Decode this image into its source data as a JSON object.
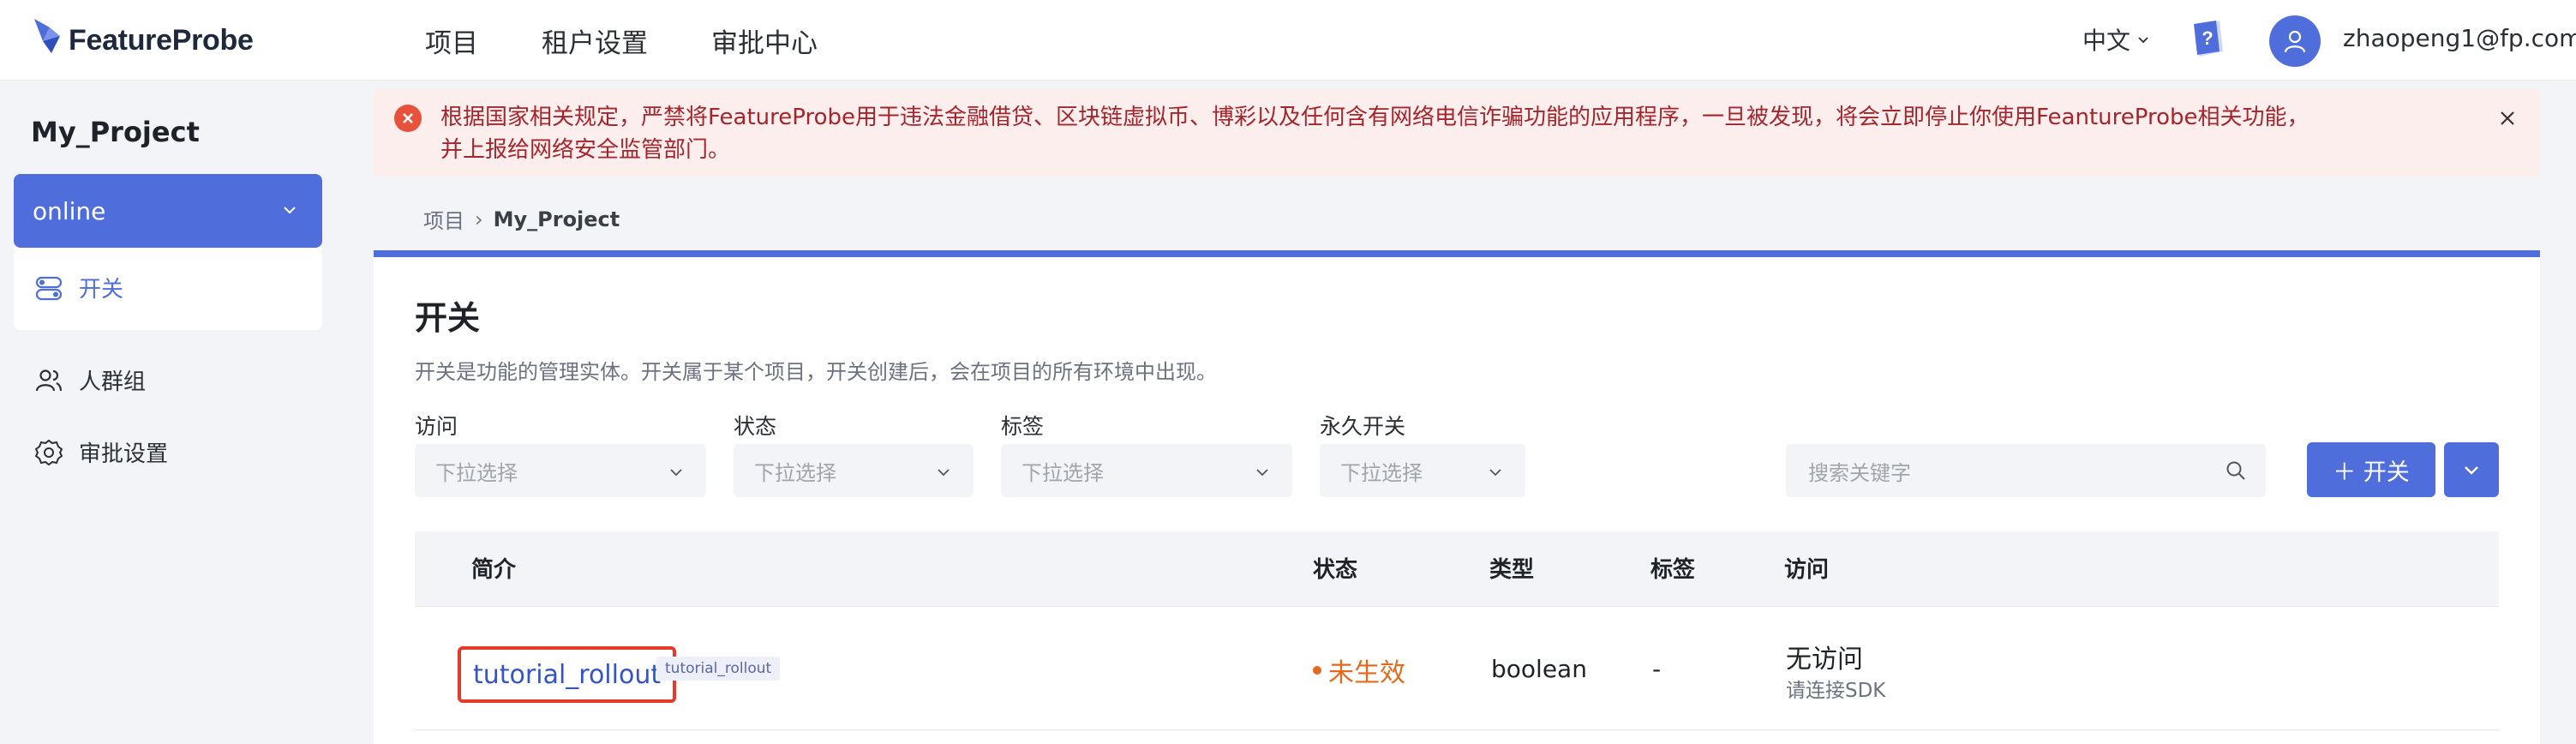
{
  "app": {
    "name": "FeatureProbe"
  },
  "nav": {
    "items": [
      "项目",
      "租户设置",
      "审批中心"
    ]
  },
  "header": {
    "language": "中文",
    "user_email": "zhaopeng1@fp.com"
  },
  "sidebar": {
    "project": "My_Project",
    "env": "online",
    "items": [
      {
        "label": "开关",
        "icon": "toggle-icon",
        "active": true
      },
      {
        "label": "人群组",
        "icon": "users-icon",
        "active": false
      },
      {
        "label": "审批设置",
        "icon": "gear-icon",
        "active": false
      }
    ]
  },
  "alert": {
    "text": "根据国家相关规定，严禁将FeatureProbe用于违法金融借贷、区块链虚拟币、博彩以及任何含有网络电信诈骗功能的应用程序，一旦被发现，将会立即停止你使用FeantureProbe相关功能，并上报给网络安全监管部门。"
  },
  "breadcrumb": {
    "root": "项目",
    "current": "My_Project"
  },
  "page": {
    "title": "开关",
    "description": "开关是功能的管理实体。开关属于某个项目，开关创建后，会在项目的所有环境中出现。"
  },
  "filters": [
    {
      "label": "访问",
      "placeholder": "下拉选择"
    },
    {
      "label": "状态",
      "placeholder": "下拉选择"
    },
    {
      "label": "标签",
      "placeholder": "下拉选择"
    },
    {
      "label": "永久开关",
      "placeholder": "下拉选择"
    }
  ],
  "search": {
    "placeholder": "搜索关键字"
  },
  "add_button": "＋ 开关",
  "table": {
    "headers": {
      "intro": "简介",
      "status": "状态",
      "type": "类型",
      "tags": "标签",
      "visit": "访问"
    },
    "rows": [
      {
        "name": "tutorial_rollout",
        "key": "tutorial_rollout",
        "status": "未生效",
        "type": "boolean",
        "tags": "-",
        "visit": "无访问",
        "visit_sub": "请连接SDK"
      }
    ]
  },
  "colors": {
    "accent": "#4f6ddb",
    "alert_bg": "#fdeeee",
    "alert_text": "#a4262c",
    "status_inactive": "#e36a1d"
  }
}
